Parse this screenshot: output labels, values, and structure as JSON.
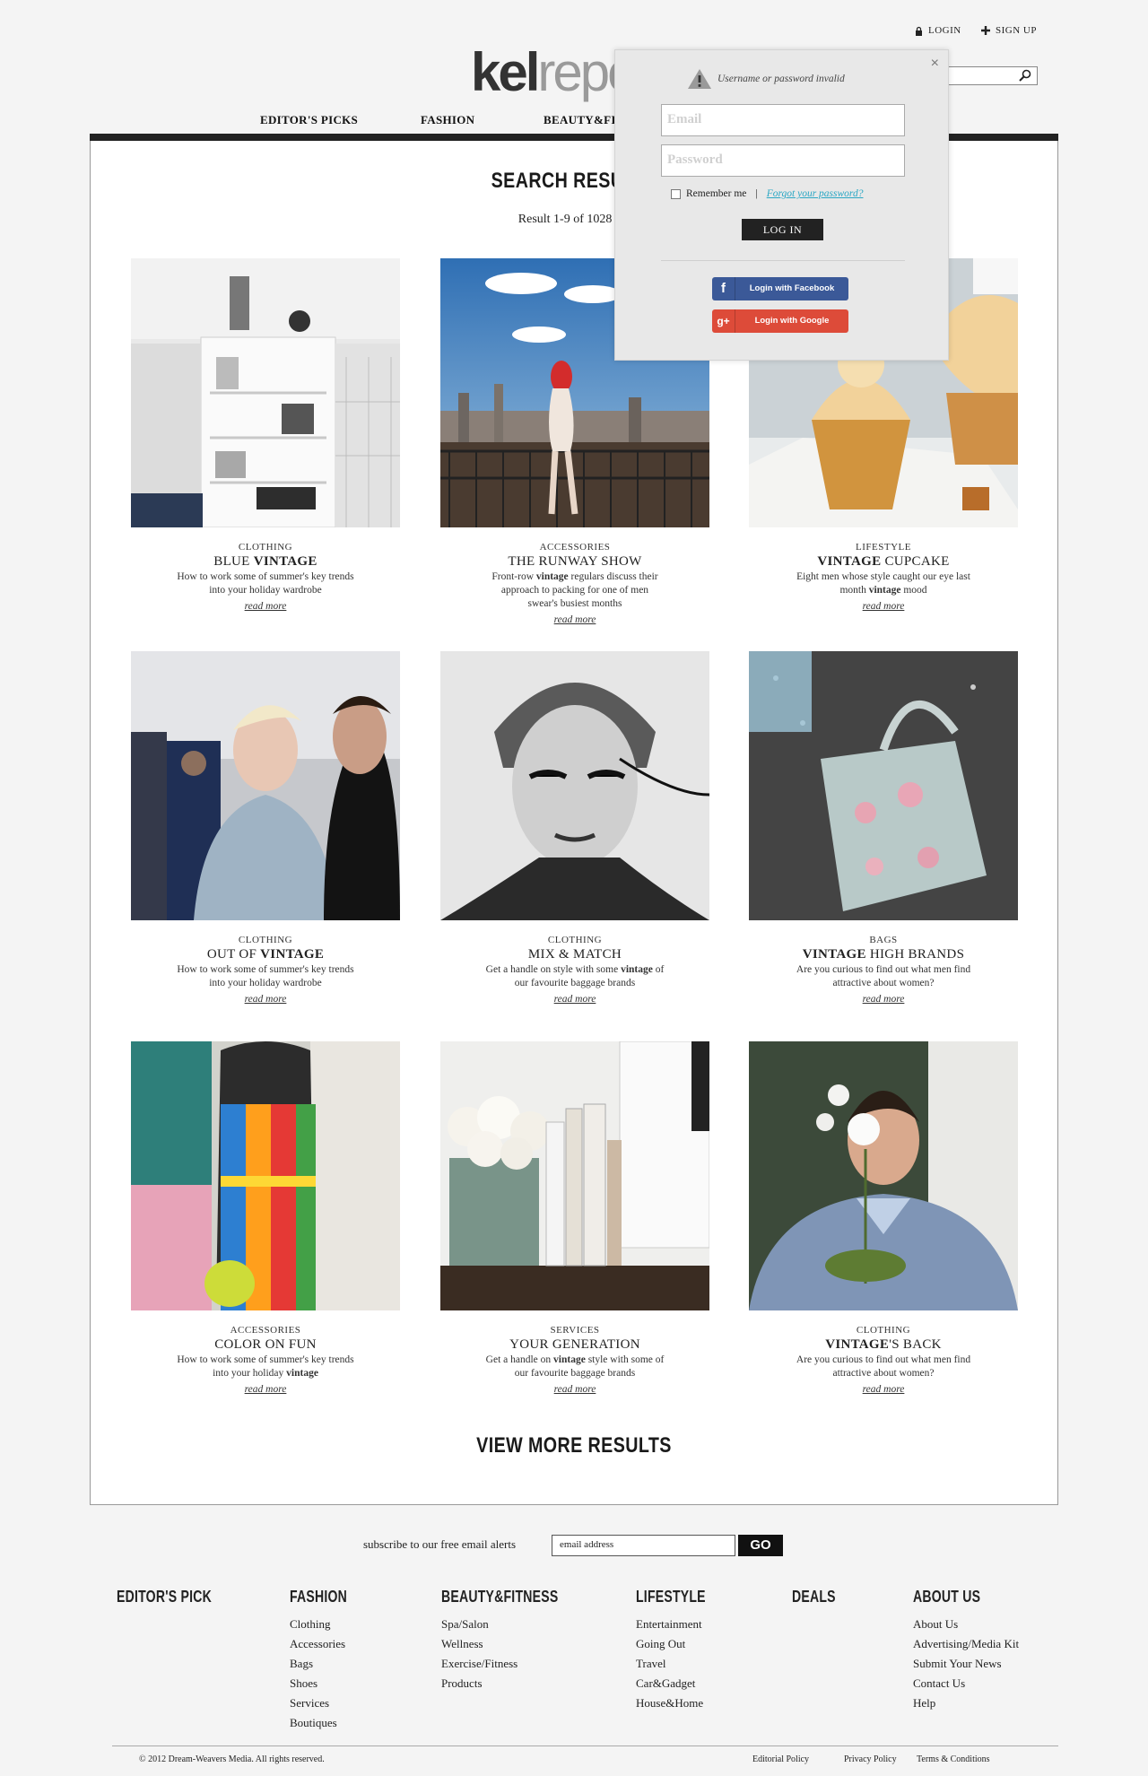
{
  "header": {
    "login_label": "LOGIN",
    "signup_label": "SIGN UP",
    "logo_a": "kel",
    "logo_b": "report",
    "search_value": "vintage"
  },
  "nav": {
    "items": [
      "EDITOR'S PICKS",
      "FASHION",
      "BEAUTY&FITNESS"
    ]
  },
  "main": {
    "title": "SEARCH RESULTS",
    "result_summary": "Result 1-9 of 1028 for",
    "view_more": "VIEW MORE RESULTS",
    "cards": [
      {
        "category": "CLOTHING",
        "title": [
          "BLUE ",
          "VINTAGE",
          ""
        ],
        "desc": [
          "How to work some of summer's key trends into your holiday wardrobe"
        ],
        "more": "read more"
      },
      {
        "category": "ACCESSORIES",
        "title": [
          "THE RUNWAY SHOW",
          "",
          ""
        ],
        "desc": [
          "Front-row ",
          "vintage",
          " regulars discuss their approach to packing for one of men swear's busiest months"
        ],
        "more": "read more"
      },
      {
        "category": "LIFESTYLE",
        "title": [
          "",
          "VINTAGE",
          " CUPCAKE"
        ],
        "desc": [
          "Eight men whose style caught our eye last month ",
          "vintage",
          " mood"
        ],
        "more": "read more"
      },
      {
        "category": "CLOTHING",
        "title": [
          "OUT OF ",
          "VINTAGE",
          ""
        ],
        "desc": [
          "How to work some of summer's key trends into your holiday wardrobe"
        ],
        "more": "read more"
      },
      {
        "category": "CLOTHING",
        "title": [
          "MIX & MATCH",
          "",
          ""
        ],
        "desc": [
          "Get a handle on style with some ",
          "vintage",
          " of our favourite baggage brands"
        ],
        "more": "read more"
      },
      {
        "category": "BAGS",
        "title": [
          "",
          "VINTAGE",
          " HIGH BRANDS"
        ],
        "desc": [
          "Are you curious to find out what men find attractive about women?"
        ],
        "more": "read more"
      },
      {
        "category": "ACCESSORIES",
        "title": [
          "COLOR ON FUN",
          "",
          ""
        ],
        "desc": [
          "How to work some of summer's key trends into your holiday ",
          "vintage",
          ""
        ],
        "more": "read more"
      },
      {
        "category": "SERVICES",
        "title": [
          "YOUR GENERATION",
          "",
          ""
        ],
        "desc": [
          "Get a handle on ",
          "vintage",
          " style with some of our favourite baggage brands"
        ],
        "more": "read more"
      },
      {
        "category": "CLOTHING",
        "title": [
          "",
          "VINTAGE",
          "'S BACK"
        ],
        "desc": [
          "Are you curious to find out what men find attractive about women?"
        ],
        "more": "read more"
      }
    ]
  },
  "login_popup": {
    "error": "Username or password invalid",
    "email_placeholder": "Email",
    "password_placeholder": "Password",
    "remember": "Remember me",
    "divider": "|",
    "forgot": "Forgot your password?",
    "login_button": "LOG IN",
    "facebook": "Login with Facebook",
    "google": "Login with Google",
    "close": "×"
  },
  "footer": {
    "subscribe_text": "subscribe to our free email alerts",
    "email_placeholder": "email address",
    "go": "GO",
    "columns": [
      {
        "title": "EDITOR'S PICK",
        "items": []
      },
      {
        "title": "FASHION",
        "items": [
          "Clothing",
          "Accessories",
          "Bags",
          "Shoes",
          "Services",
          "Boutiques"
        ]
      },
      {
        "title": "BEAUTY&FITNESS",
        "items": [
          "Spa/Salon",
          "Wellness",
          "Exercise/Fitness",
          "Products"
        ]
      },
      {
        "title": "LIFESTYLE",
        "items": [
          "Entertainment",
          "Going Out",
          "Travel",
          "Car&Gadget",
          "House&Home"
        ]
      },
      {
        "title": "DEALS",
        "items": []
      },
      {
        "title": "ABOUT US",
        "items": [
          "About Us",
          "Advertising/Media Kit",
          "Submit Your News",
          "Contact Us",
          "Help"
        ]
      }
    ],
    "copyright": "© 2012 Dream-Weavers Media. All rights reserved.",
    "links": [
      "Editorial Policy",
      "Privacy Policy",
      "Terms & Conditions"
    ]
  },
  "colors": {
    "accent_link": "#2aa7c4",
    "facebook": "#3b5998",
    "google": "#dd4b39"
  }
}
